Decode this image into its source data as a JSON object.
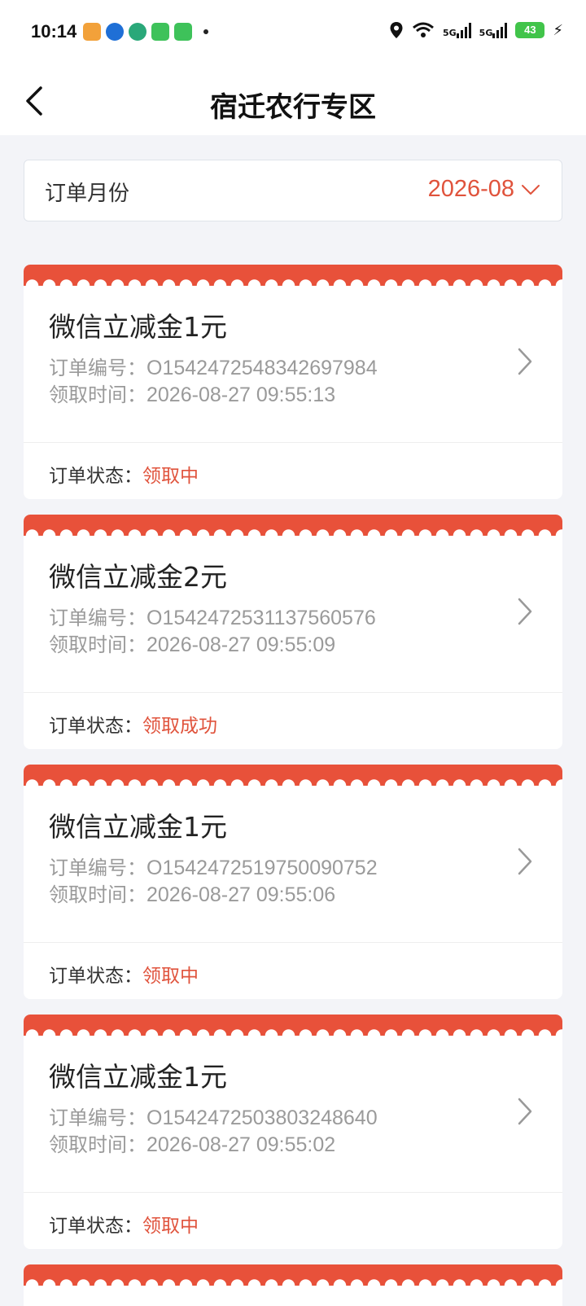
{
  "statusbar": {
    "time": "10:14",
    "network_1": "5G",
    "network_2": "5G",
    "battery": "43"
  },
  "header": {
    "title": "宿迁农行专区"
  },
  "filter": {
    "label": "订单月份",
    "value": "2026-08"
  },
  "labels": {
    "order_no": "订单编号：",
    "claim_time": "领取时间：",
    "status": "订单状态："
  },
  "orders": [
    {
      "title": "微信立减金1元",
      "order_no": "O1542472548342697984",
      "time": "2026-08-27 09:55:13",
      "status": "领取中"
    },
    {
      "title": "微信立减金2元",
      "order_no": "O1542472531137560576",
      "time": "2026-08-27 09:55:09",
      "status": "领取成功"
    },
    {
      "title": "微信立减金1元",
      "order_no": "O1542472519750090752",
      "time": "2026-08-27 09:55:06",
      "status": "领取中"
    },
    {
      "title": "微信立减金1元",
      "order_no": "O1542472503803248640",
      "time": "2026-08-27 09:55:02",
      "status": "领取中"
    }
  ],
  "colors": {
    "accent": "#e0533c",
    "card_header": "#e8513a",
    "page_bg": "#f3f4f8"
  }
}
